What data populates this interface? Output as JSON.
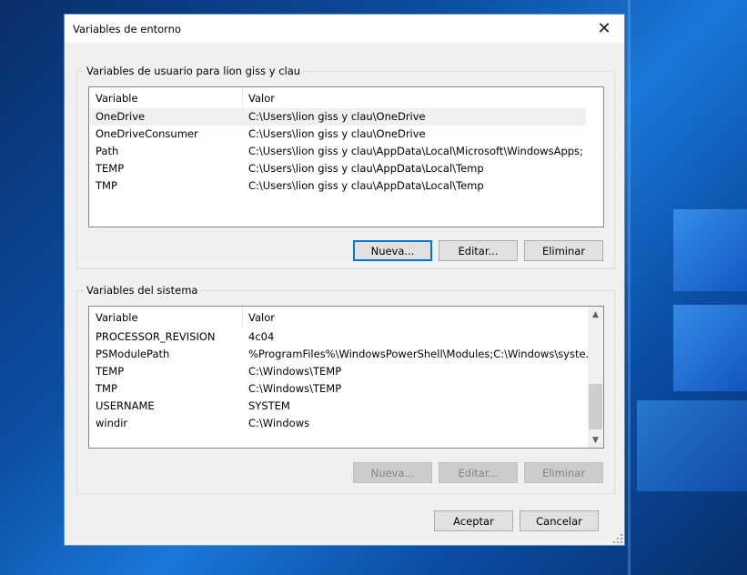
{
  "window": {
    "title": "Variables de entorno",
    "close_glyph": "✕"
  },
  "user_section": {
    "legend": "Variables de usuario para lion giss y clau",
    "headers": {
      "variable": "Variable",
      "value": "Valor"
    },
    "rows": [
      {
        "name": "OneDrive",
        "value": "C:\\Users\\lion giss y clau\\OneDrive",
        "selected": true
      },
      {
        "name": "OneDriveConsumer",
        "value": "C:\\Users\\lion giss y clau\\OneDrive",
        "selected": false
      },
      {
        "name": "Path",
        "value": "C:\\Users\\lion giss y clau\\AppData\\Local\\Microsoft\\WindowsApps;",
        "selected": false
      },
      {
        "name": "TEMP",
        "value": "C:\\Users\\lion giss y clau\\AppData\\Local\\Temp",
        "selected": false
      },
      {
        "name": "TMP",
        "value": "C:\\Users\\lion giss y clau\\AppData\\Local\\Temp",
        "selected": false
      }
    ],
    "buttons": {
      "new": "Nueva...",
      "edit": "Editar...",
      "delete": "Eliminar"
    }
  },
  "system_section": {
    "legend": "Variables del sistema",
    "headers": {
      "variable": "Variable",
      "value": "Valor"
    },
    "rows": [
      {
        "name": "PROCESSOR_REVISION",
        "value": "4c04"
      },
      {
        "name": "PSModulePath",
        "value": "%ProgramFiles%\\WindowsPowerShell\\Modules;C:\\Windows\\syste..."
      },
      {
        "name": "TEMP",
        "value": "C:\\Windows\\TEMP"
      },
      {
        "name": "TMP",
        "value": "C:\\Windows\\TEMP"
      },
      {
        "name": "USERNAME",
        "value": "SYSTEM"
      },
      {
        "name": "windir",
        "value": "C:\\Windows"
      }
    ],
    "buttons": {
      "new": "Nueva...",
      "edit": "Editar...",
      "delete": "Eliminar"
    }
  },
  "footer": {
    "ok": "Aceptar",
    "cancel": "Cancelar"
  },
  "colors": {
    "accent": "#0078d7",
    "selected_row": "#f0f0f0"
  }
}
